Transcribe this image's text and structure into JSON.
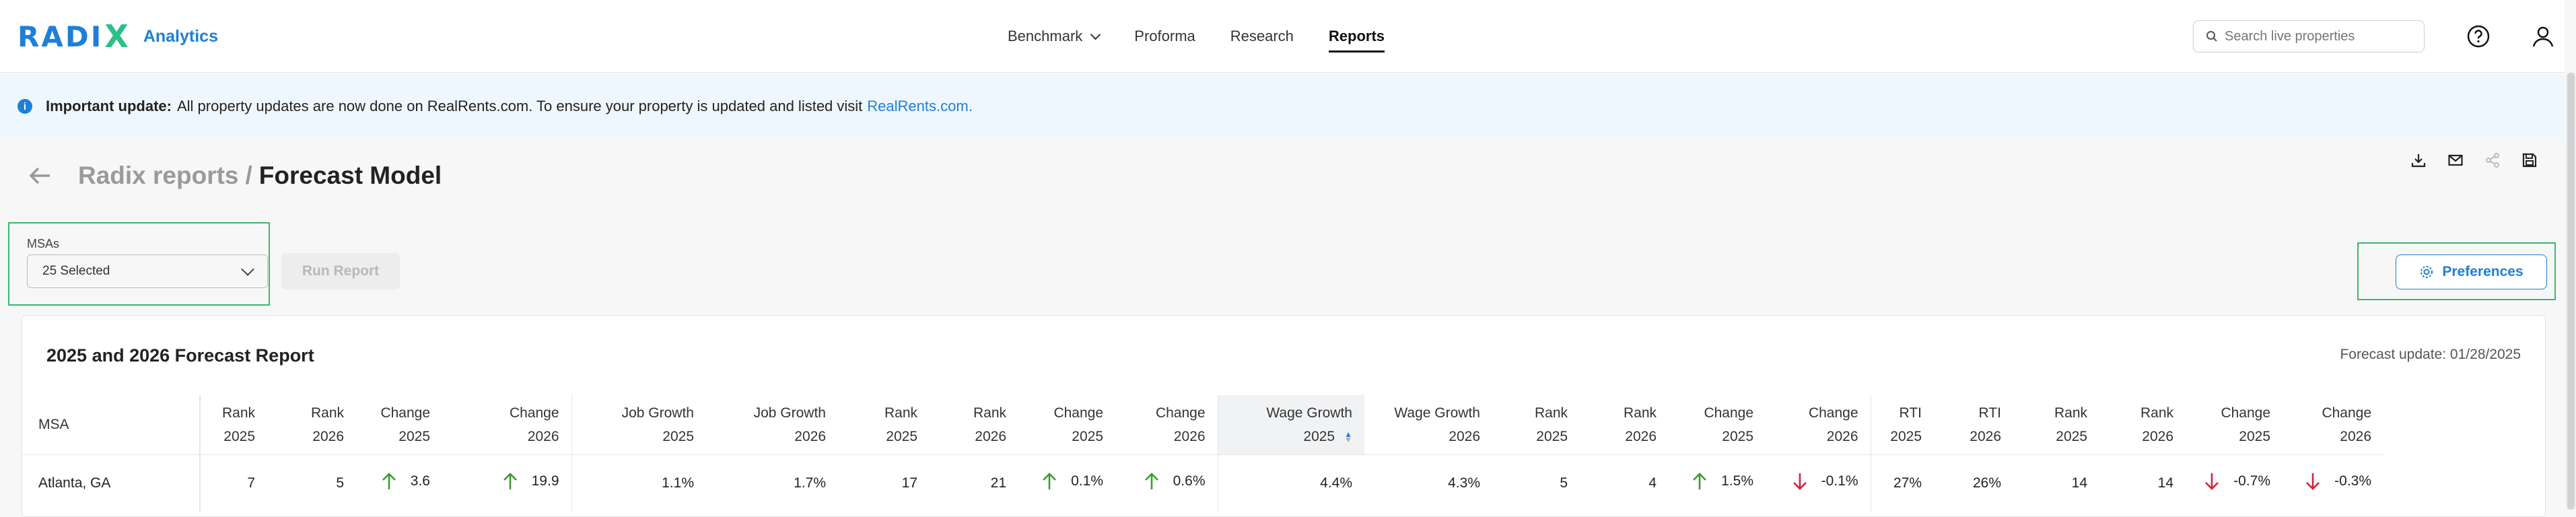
{
  "brand": {
    "logo_text": "RADI",
    "logo_x": "X",
    "product": "Analytics"
  },
  "nav": {
    "items": [
      {
        "label": "Benchmark",
        "dropdown": true
      },
      {
        "label": "Proforma"
      },
      {
        "label": "Research"
      },
      {
        "label": "Reports",
        "active": true
      }
    ],
    "search_placeholder": "Search live properties"
  },
  "banner": {
    "bold": "Important update:",
    "text": "All property updates are now done on RealRents.com. To ensure your property is updated and listed visit",
    "link": "RealRents.com."
  },
  "breadcrumb": {
    "parent": "Radix reports",
    "sep": "/",
    "current": "Forecast Model"
  },
  "filters": {
    "msa_label": "MSAs",
    "msa_value": "25 Selected",
    "run_label": "Run Report",
    "preferences_label": "Preferences"
  },
  "report": {
    "title": "2025 and 2026 Forecast Report",
    "forecast_update": "Forecast update: 01/28/2025",
    "columns": [
      {
        "l1": "MSA",
        "l2": ""
      },
      {
        "l1": "Rank",
        "l2": "2025"
      },
      {
        "l1": "Rank",
        "l2": "2026"
      },
      {
        "l1": "Change",
        "l2": "2025"
      },
      {
        "l1": "Change",
        "l2": "2026"
      },
      {
        "l1": "Job Growth",
        "l2": "2025"
      },
      {
        "l1": "Job Growth",
        "l2": "2026"
      },
      {
        "l1": "Rank",
        "l2": "2025"
      },
      {
        "l1": "Rank",
        "l2": "2026"
      },
      {
        "l1": "Change",
        "l2": "2025"
      },
      {
        "l1": "Change",
        "l2": "2026"
      },
      {
        "l1": "Wage Growth",
        "l2": "2025"
      },
      {
        "l1": "Wage Growth",
        "l2": "2026"
      },
      {
        "l1": "Rank",
        "l2": "2025"
      },
      {
        "l1": "Rank",
        "l2": "2026"
      },
      {
        "l1": "Change",
        "l2": "2025"
      },
      {
        "l1": "Change",
        "l2": "2026"
      },
      {
        "l1": "RTI",
        "l2": "2025"
      },
      {
        "l1": "RTI",
        "l2": "2026"
      },
      {
        "l1": "Rank",
        "l2": "2025"
      },
      {
        "l1": "Rank",
        "l2": "2026"
      },
      {
        "l1": "Change",
        "l2": "2025"
      },
      {
        "l1": "Change",
        "l2": "2026"
      }
    ],
    "rows": [
      {
        "msa": "Atlanta, GA",
        "cells": [
          "7",
          "5",
          "3.6",
          "19.9",
          "1.1%",
          "1.7%",
          "17",
          "21",
          "0.1%",
          "0.6%",
          "4.4%",
          "4.3%",
          "5",
          "4",
          "1.5%",
          "-0.1%",
          "27%",
          "26%",
          "14",
          "14",
          "-0.7%",
          "-0.3%"
        ],
        "arrows": [
          "",
          "",
          "up",
          "up",
          "",
          "",
          "",
          "",
          "up",
          "up",
          "",
          "",
          "",
          "",
          "up",
          "down",
          "",
          "",
          "",
          "",
          "down",
          "down"
        ]
      }
    ]
  },
  "colors": {
    "accent": "#1e7fd8",
    "up": "#3a9b2f",
    "down": "#d6203a",
    "highlight": "#39b86b"
  }
}
